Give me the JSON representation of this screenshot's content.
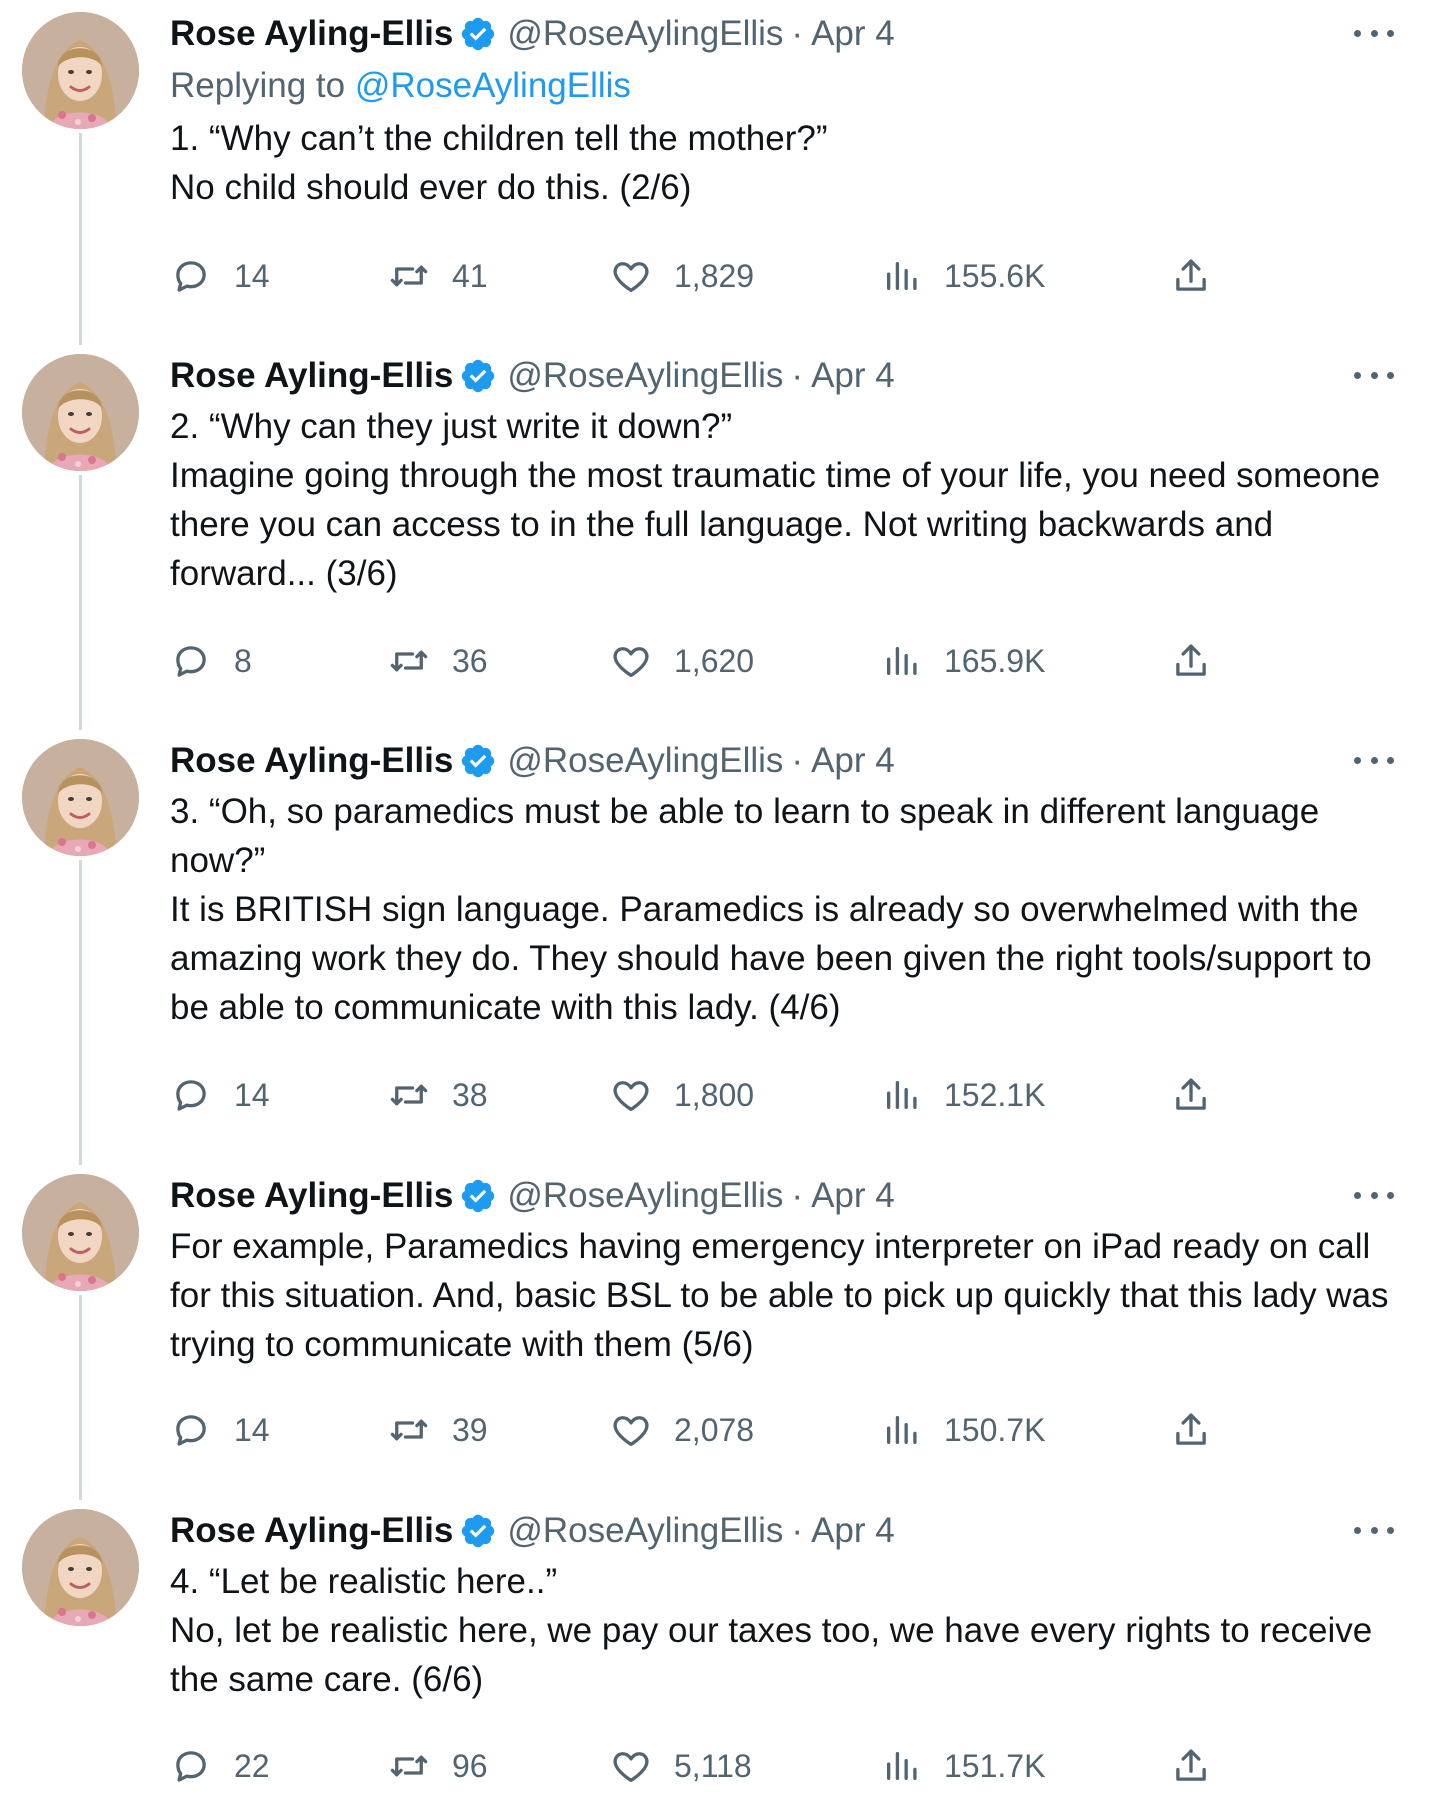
{
  "colors": {
    "text": "#0f1419",
    "muted": "#536471",
    "accent": "#1d9bf0",
    "thread_line": "#cfd9de"
  },
  "tweets": [
    {
      "name": "Rose Ayling-Ellis",
      "handle": "@RoseAylingEllis",
      "separator": "·",
      "date": "Apr 4",
      "replying_prefix": "Replying to ",
      "replying_to": "@RoseAylingEllis",
      "text": "1. “Why can’t the children tell the mother?”\nNo child should ever do this. (2/6)",
      "replies": "14",
      "retweets": "41",
      "likes": "1,829",
      "views": "155.6K"
    },
    {
      "name": "Rose Ayling-Ellis",
      "handle": "@RoseAylingEllis",
      "separator": "·",
      "date": "Apr 4",
      "text": "2. “Why can they just write it down?”\nImagine going through the most traumatic time of your life, you need someone there you can access to in the full language. Not writing backwards and forward... (3/6)",
      "replies": "8",
      "retweets": "36",
      "likes": "1,620",
      "views": "165.9K"
    },
    {
      "name": "Rose Ayling-Ellis",
      "handle": "@RoseAylingEllis",
      "separator": "·",
      "date": "Apr 4",
      "text": "3. “Oh, so paramedics must be able to learn to speak in different language now?”\nIt is BRITISH sign language. Paramedics is already so overwhelmed with the amazing work they do. They should have been given the right tools/support to be able to communicate with this lady. (4/6)",
      "replies": "14",
      "retweets": "38",
      "likes": "1,800",
      "views": "152.1K"
    },
    {
      "name": "Rose Ayling-Ellis",
      "handle": "@RoseAylingEllis",
      "separator": "·",
      "date": "Apr 4",
      "text": "For example, Paramedics having emergency interpreter on iPad ready on call for this situation. And, basic BSL to be able to pick up quickly that this lady was trying to communicate with them (5/6)",
      "replies": "14",
      "retweets": "39",
      "likes": "2,078",
      "views": "150.7K"
    },
    {
      "name": "Rose Ayling-Ellis",
      "handle": "@RoseAylingEllis",
      "separator": "·",
      "date": "Apr 4",
      "text": "4. “Let be realistic here..”\nNo, let be realistic here, we pay our taxes too, we have every rights to receive the same care. (6/6)",
      "replies": "22",
      "retweets": "96",
      "likes": "5,118",
      "views": "151.7K"
    }
  ]
}
